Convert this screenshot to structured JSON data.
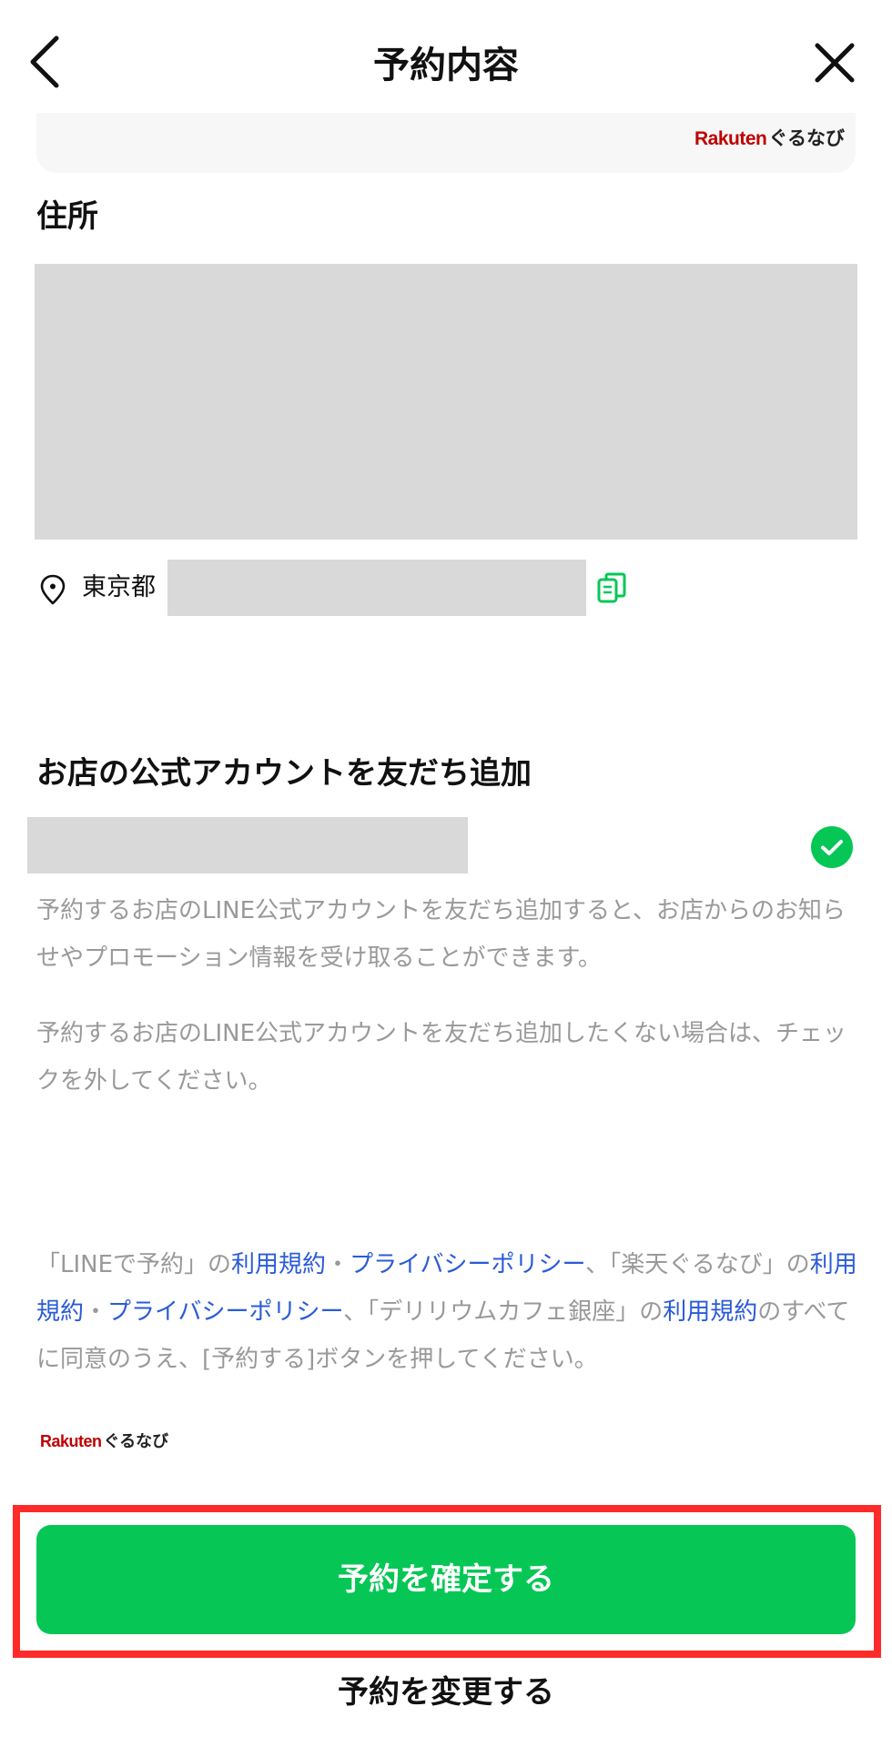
{
  "header": {
    "title": "予約内容"
  },
  "logo": {
    "rakuten": "Rakuten",
    "gurunavi": "ぐるなび"
  },
  "address": {
    "title": "住所",
    "prefix": "東京都"
  },
  "friend": {
    "title": "お店の公式アカウントを友だち追加",
    "checked": true,
    "desc1": "予約するお店のLINE公式アカウントを友だち追加すると、お店からのお知らせやプロモーション情報を受け取ることができます。",
    "desc2": "予約するお店のLINE公式アカウントを友だち追加したくない場合は、チェックを外してください。"
  },
  "terms": {
    "t1": "「LINEで予約」の",
    "l1": "利用規約",
    "t2": "・",
    "l2": "プライバシーポリシー",
    "t3": "、「楽天ぐるなび」の",
    "l3": "利用規約",
    "t4": "・",
    "l4": "プライバシーポリシー",
    "t5": "、「デリリウムカフェ銀座」の",
    "l5": "利用規約",
    "t6": "のすべてに同意のうえ、[予約する]ボタンを押してください。"
  },
  "actions": {
    "confirm": "予約を確定する",
    "change": "予約を変更する"
  },
  "colors": {
    "accent": "#06c755",
    "link": "#2a5bd7",
    "highlight": "#ff2a2a",
    "logo_red": "#bf0000"
  },
  "icons": {
    "back": "chevron-left-icon",
    "close": "close-icon",
    "location": "map-pin-icon",
    "copy": "copy-icon",
    "check": "check-icon"
  }
}
